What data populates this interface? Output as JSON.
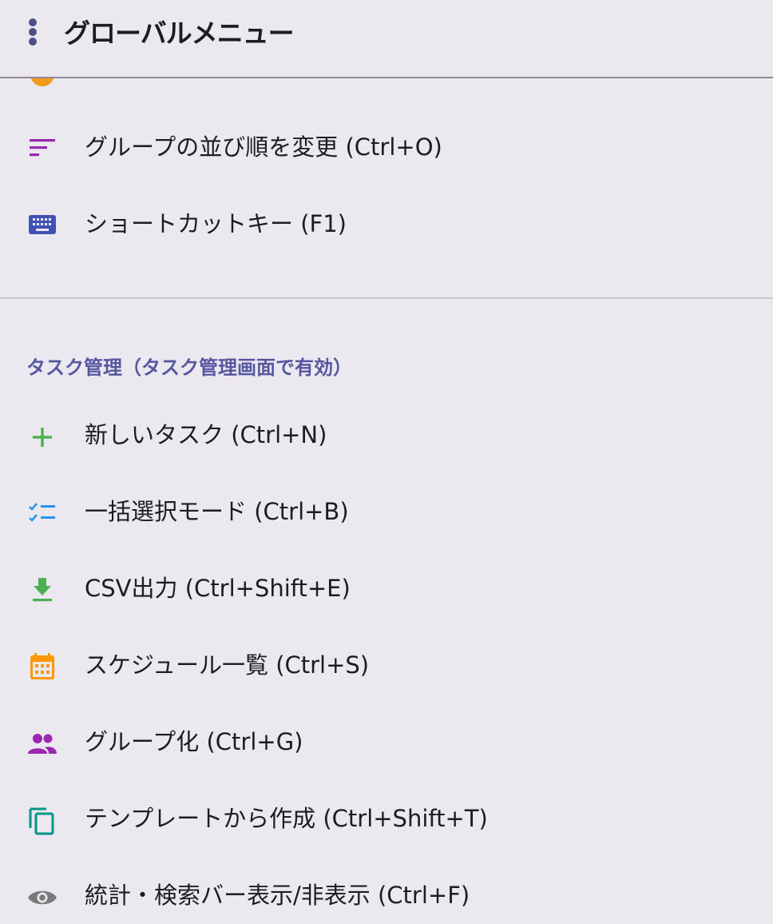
{
  "header": {
    "title": "グローバルメニュー",
    "menu_icon": "more-vert-icon"
  },
  "partial_item": {
    "label": "",
    "icon": "circle-icon",
    "icon_color": "#F29A1B"
  },
  "top_items": [
    {
      "label": "グループの並び順を変更 (Ctrl+O)",
      "icon": "sort-icon",
      "color": "#9C27B0"
    },
    {
      "label": "ショートカットキー (F1)",
      "icon": "keyboard-icon",
      "color": "#3F51B5"
    }
  ],
  "section": {
    "title": "タスク管理（タスク管理画面で有効）",
    "color": "#5557A1"
  },
  "task_items": [
    {
      "label": "新しいタスク (Ctrl+N)",
      "icon": "add-icon",
      "color": "#4CAF50"
    },
    {
      "label": "一括選択モード (Ctrl+B)",
      "icon": "checklist-icon",
      "color": "#2196F3"
    },
    {
      "label": "CSV出力 (Ctrl+Shift+E)",
      "icon": "download-icon",
      "color": "#4CAF50"
    },
    {
      "label": "スケジュール一覧 (Ctrl+S)",
      "icon": "calendar-icon",
      "color": "#FF9800"
    },
    {
      "label": "グループ化 (Ctrl+G)",
      "icon": "group-icon",
      "color": "#9C27B0"
    },
    {
      "label": "テンプレートから作成 (Ctrl+Shift+T)",
      "icon": "copy-icon",
      "color": "#009688"
    },
    {
      "label": "統計・検索バー表示/非表示 (Ctrl+F)",
      "icon": "eye-icon",
      "color": "#7A7A7A"
    }
  ]
}
